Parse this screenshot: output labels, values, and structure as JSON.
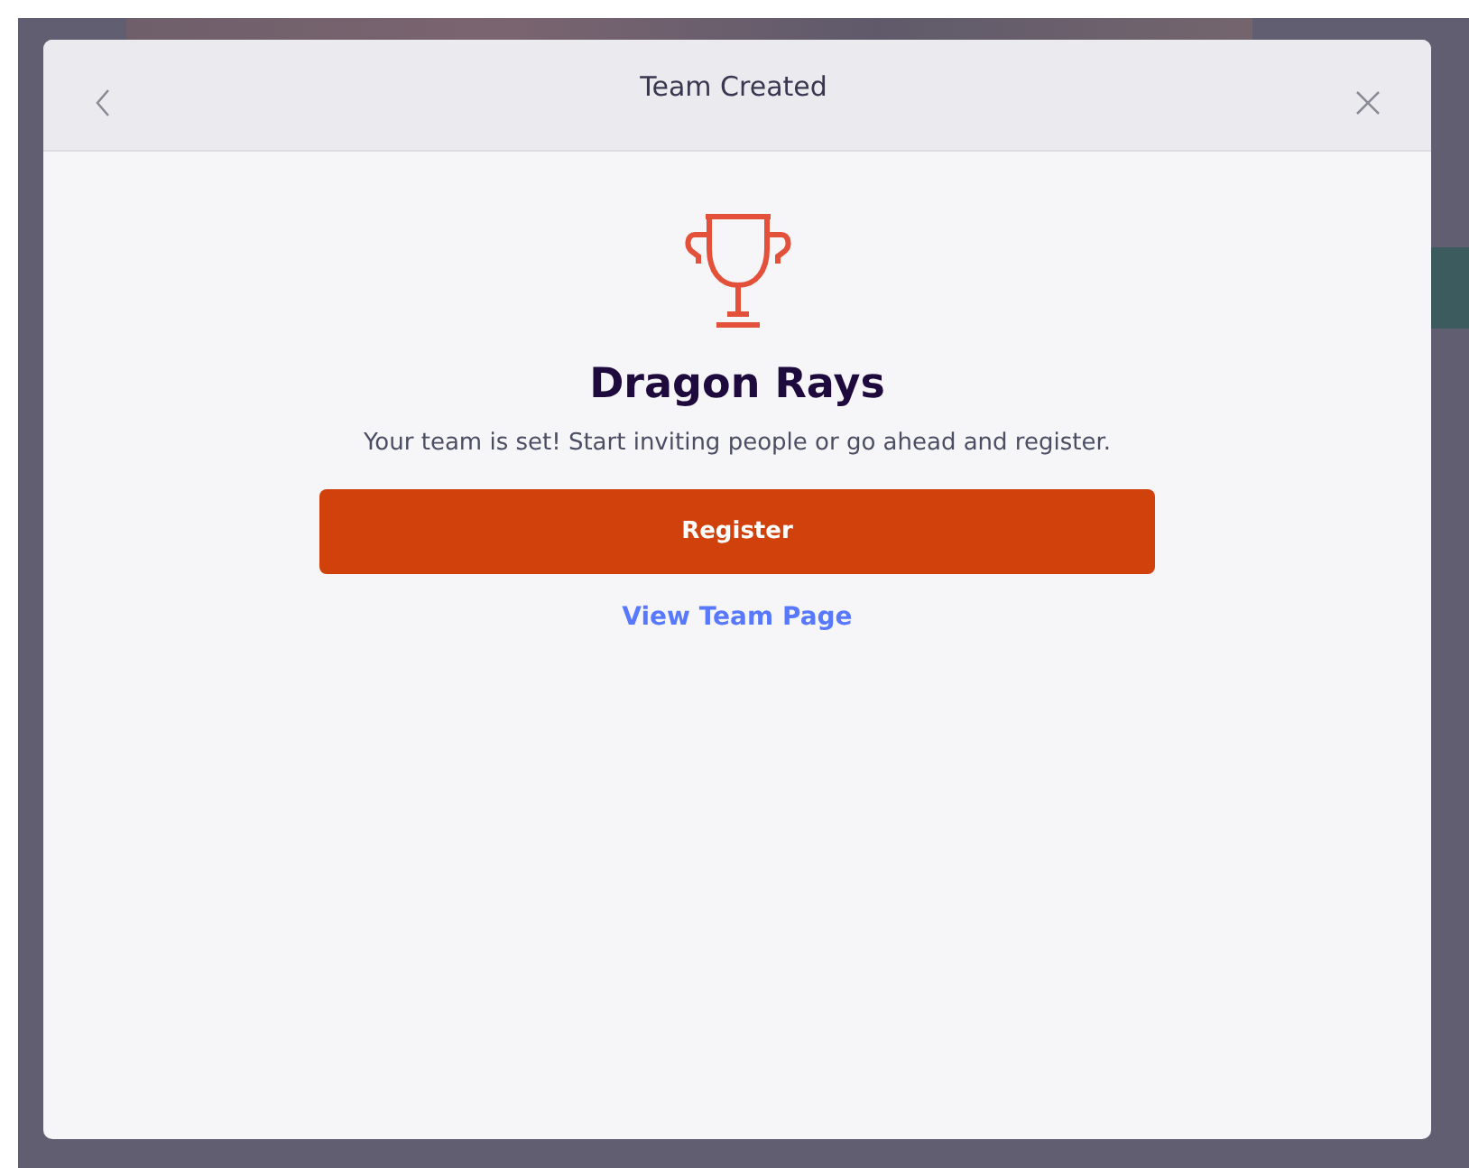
{
  "dialog": {
    "title": "Team Created",
    "team_name": "Dragon Rays",
    "message": "Your team is set! Start inviting people or go ahead and register.",
    "primary_button": "Register",
    "link": "View Team Page"
  }
}
